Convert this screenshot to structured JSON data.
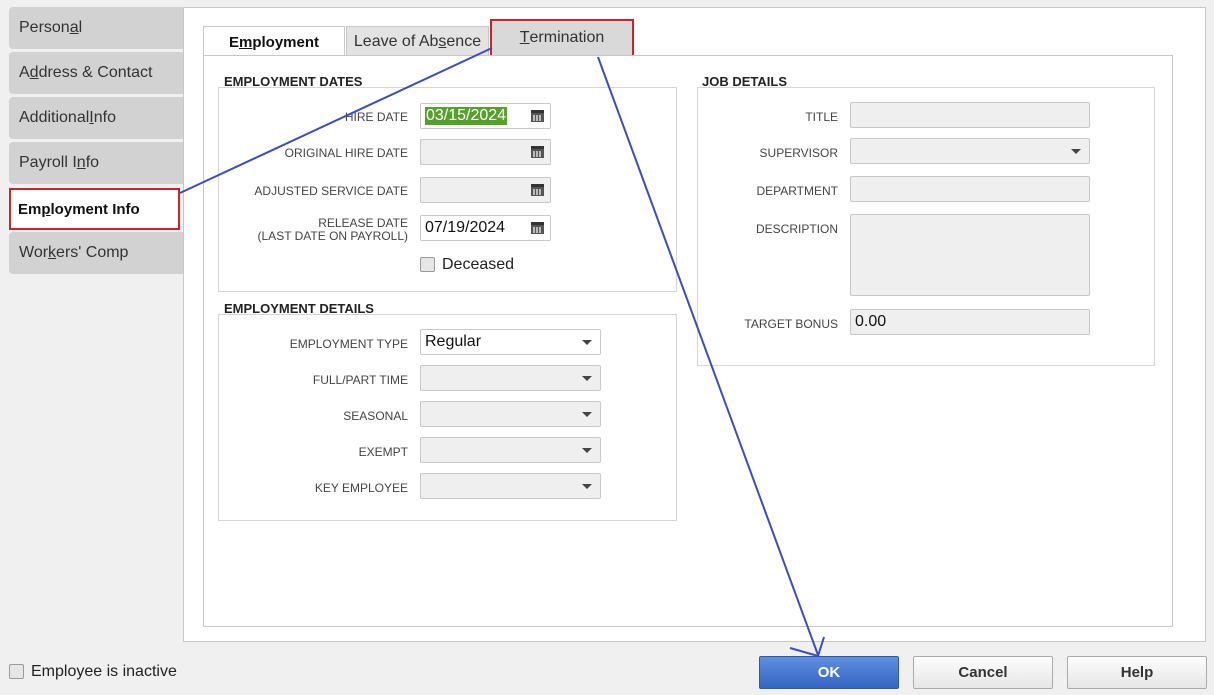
{
  "sidebar": {
    "items": [
      {
        "label_pre": "Person",
        "label_u": "a",
        "label_post": "l"
      },
      {
        "label_pre": "A",
        "label_u": "d",
        "label_post": "dress & Contact"
      },
      {
        "label_pre": "Additional ",
        "label_u": "I",
        "label_post": "nfo"
      },
      {
        "label_pre": "Payroll I",
        "label_u": "n",
        "label_post": "fo"
      },
      {
        "label_pre": "Em",
        "label_u": "p",
        "label_post": "loyment Info"
      },
      {
        "label_pre": "Wor",
        "label_u": "k",
        "label_post": "ers' Comp"
      }
    ]
  },
  "tabs": [
    {
      "label_pre": "E",
      "label_u": "m",
      "label_post": "ployment"
    },
    {
      "label_pre": "Leave of Ab",
      "label_u": "s",
      "label_post": "ence"
    },
    {
      "label_pre": "",
      "label_u": "T",
      "label_post": "ermination"
    }
  ],
  "employment_dates": {
    "title": "EMPLOYMENT DATES",
    "hire_date_label": "HIRE DATE",
    "hire_date": "03/15/2024",
    "original_hire_label": "ORIGINAL HIRE DATE",
    "original_hire": "",
    "adjusted_label": "ADJUSTED SERVICE DATE",
    "adjusted": "",
    "release_label_1": "RELEASE DATE",
    "release_label_2": "(LAST DATE ON PAYROLL)",
    "release_date": "07/19/2024",
    "deceased_label": "Deceased"
  },
  "employment_details": {
    "title": "EMPLOYMENT DETAILS",
    "type_label": "EMPLOYMENT TYPE",
    "type_value": "Regular",
    "fullpart_label": "FULL/PART TIME",
    "seasonal_label": "SEASONAL",
    "exempt_label": "EXEMPT",
    "key_label": "KEY EMPLOYEE"
  },
  "job_details": {
    "title": "JOB DETAILS",
    "title_label": "TITLE",
    "supervisor_label": "SUPERVISOR",
    "department_label": "DEPARTMENT",
    "description_label": "DESCRIPTION",
    "bonus_label": "TARGET BONUS",
    "bonus_value": "0.00"
  },
  "footer": {
    "inactive_label": "Employee is inactive",
    "ok": "OK",
    "cancel": "Cancel",
    "help": "Help"
  },
  "colors": {
    "highlight": "#d0202a",
    "annotation_line": "#3f4bbf",
    "ok_button": "#3465c2",
    "hire_date_selection": "#55a12a"
  }
}
